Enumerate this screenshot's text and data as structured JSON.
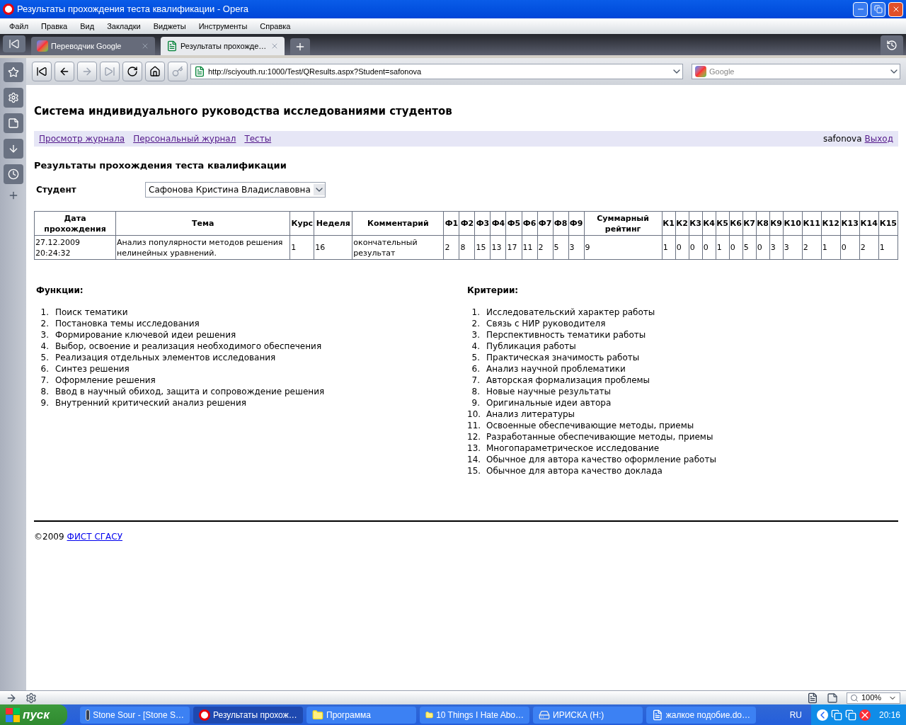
{
  "window": {
    "title": "Результаты прохождения теста квалификации - Opera"
  },
  "menu": [
    "Файл",
    "Правка",
    "Вид",
    "Закладки",
    "Виджеты",
    "Инструменты",
    "Справка"
  ],
  "tabs": [
    {
      "label": "Переводчик Google",
      "selected": false,
      "kind": "google"
    },
    {
      "label": "Результаты прохожде…",
      "selected": true,
      "kind": "page"
    }
  ],
  "address": {
    "url": "http://sciyouth.ru:1000/Test/QResults.aspx?Student=safonova"
  },
  "search": {
    "placeholder": "Google"
  },
  "page": {
    "site_title": "Система индивидуального руководства исследованиями студентов",
    "nav": [
      "Просмотр журнала",
      "Персональный журнал",
      "Тесты"
    ],
    "user": "safonova",
    "logout": "Выход",
    "heading": "Результаты прохождения теста квалификации",
    "student_label": "Студент",
    "student_value": "Сафонова Кристина Владиславовна",
    "table": {
      "columns": [
        "Дата прохождения",
        "Тема",
        "Курс",
        "Неделя",
        "Комментарий",
        "Ф1",
        "Ф2",
        "Ф3",
        "Ф4",
        "Ф5",
        "Ф6",
        "Ф7",
        "Ф8",
        "Ф9",
        "Суммарный рейтинг",
        "К1",
        "К2",
        "К3",
        "К4",
        "К5",
        "К6",
        "К7",
        "К8",
        "К9",
        "К10",
        "К11",
        "К12",
        "К13",
        "К14",
        "К15"
      ],
      "rows": [
        [
          "27.12.2009 20:24:32",
          "Анализ популярности методов решения нелинейных уравнений.",
          "1",
          "16",
          "окончательный результат",
          "2",
          "8",
          "15",
          "13",
          "17",
          "11",
          "2",
          "5",
          "3",
          "9",
          "1",
          "0",
          "0",
          "0",
          "1",
          "0",
          "5",
          "0",
          "3",
          "3",
          "2",
          "1",
          "0",
          "2",
          "1"
        ]
      ]
    },
    "functions": {
      "title": "Функции:",
      "items": [
        {
          "number": "1.",
          "text": "Поиск тематики"
        },
        {
          "number": "2.",
          "text": "Постановка темы исследования"
        },
        {
          "number": "3.",
          "text": "Формирование ключевой идеи решения"
        },
        {
          "number": "4.",
          "text": "Выбор, освоение и реализация необходимого обеспечения"
        },
        {
          "number": "5.",
          "text": "Реализация отдельных элементов исследования"
        },
        {
          "number": "6.",
          "text": "Синтез решения"
        },
        {
          "number": "7.",
          "text": "Оформление решения"
        },
        {
          "number": "8.",
          "text": "Ввод в научный обиход, защита и сопровождение решения"
        },
        {
          "number": "9.",
          "text": "Внутренний критический анализ решения"
        }
      ]
    },
    "criteria": {
      "title": "Критерии:",
      "items": [
        {
          "number": "1.",
          "text": "Исследовательский характер работы"
        },
        {
          "number": "2.",
          "text": "Связь с НИР руководителя"
        },
        {
          "number": "3.",
          "text": "Перспективность тематики работы"
        },
        {
          "number": "4.",
          "text": "Публикация работы"
        },
        {
          "number": "5.",
          "text": "Практическая значимость работы"
        },
        {
          "number": "6.",
          "text": "Анализ научной проблематики"
        },
        {
          "number": "7.",
          "text": "Авторская формализация проблемы"
        },
        {
          "number": "8.",
          "text": "Новые научные результаты"
        },
        {
          "number": "9.",
          "text": "Оригинальные идеи автора"
        },
        {
          "number": "10.",
          "text": "Анализ литературы"
        },
        {
          "number": "11.",
          "text": "Освоенные обеспечивающие методы, приемы"
        },
        {
          "number": "12.",
          "text": "Разработанные обеспечивающие методы, приемы"
        },
        {
          "number": "13.",
          "text": "Многопараметрическое исследование"
        },
        {
          "number": "14.",
          "text": "Обычное для автора качество оформление работы"
        },
        {
          "number": "15.",
          "text": "Обычное для автора качество доклада"
        }
      ]
    },
    "footer": {
      "copyright": "©2009",
      "link": "ФИСТ СГАСУ"
    }
  },
  "status_bar": {
    "zoom": "100%"
  },
  "taskbar": {
    "start": "пуск",
    "items": [
      {
        "label": "Stone Sour - [Stone S…",
        "selected": false,
        "kind": "player"
      },
      {
        "label": "Результаты прохож…",
        "selected": true,
        "kind": "opera"
      },
      {
        "label": "Программа",
        "selected": false,
        "kind": "folder"
      },
      {
        "label": "10 Things I Hate Abo…",
        "selected": false,
        "kind": "folder"
      },
      {
        "label": "ИРИСКА (H:)",
        "selected": false,
        "kind": "drive"
      },
      {
        "label": "жалкое подобие.do…",
        "selected": false,
        "kind": "word"
      }
    ],
    "lang": "RU",
    "clock": "20:16"
  }
}
